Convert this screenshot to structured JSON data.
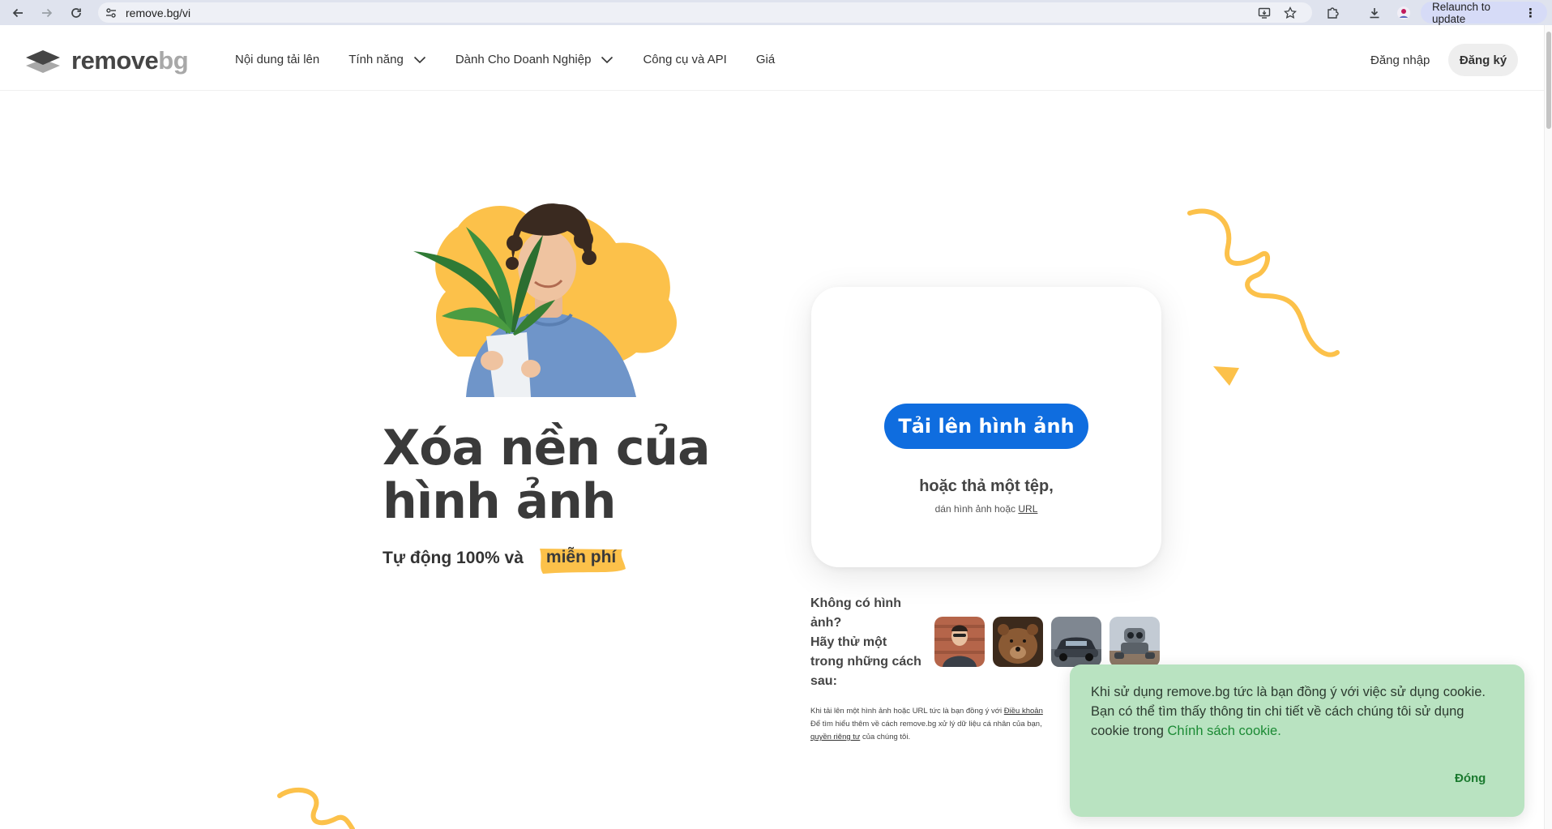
{
  "browser": {
    "url": "remove.bg/vi",
    "relaunch_label": "Relaunch to update"
  },
  "header": {
    "logo_text_main": "remove",
    "logo_text_bg": "bg",
    "menu": [
      {
        "label": "Nội dung tải lên",
        "has_dropdown": false
      },
      {
        "label": "Tính năng",
        "has_dropdown": true
      },
      {
        "label": "Dành Cho Doanh Nghiệp",
        "has_dropdown": true
      },
      {
        "label": "Công cụ và API",
        "has_dropdown": false
      },
      {
        "label": "Giá",
        "has_dropdown": false
      }
    ],
    "login_label": "Đăng nhập",
    "signup_label": "Đăng ký"
  },
  "hero": {
    "title_line1": "Xóa nền của",
    "title_line2": "hình ảnh",
    "subtitle_prefix": "Tự động 100% và",
    "subtitle_highlight": "miễn phí"
  },
  "upload": {
    "button_label": "Tải lên hình ảnh",
    "drop_text": "hoặc thả một tệp,",
    "paste_text": "dán hình ảnh hoặc",
    "paste_link": "URL"
  },
  "samples": {
    "line1": "Không có hình",
    "line2": "ảnh?",
    "line3": "Hãy thử một",
    "line4": "trong những cách",
    "line5": "sau:",
    "thumbs": [
      "person",
      "bear",
      "car",
      "robot"
    ]
  },
  "legal": {
    "line1_prefix": "Khi tải lên một hình ảnh hoặc URL tức là bạn đồng ý với",
    "line1_link": "Điều khoản",
    "line2": "Để tìm hiểu thêm về cách remove.bg xử lý dữ liệu cá nhân của bạn,",
    "line3_link": "quyền riêng tư",
    "line3_suffix": "của chúng tôi."
  },
  "cookie": {
    "message": "Khi sử dụng remove.bg tức là bạn đồng ý với việc sử dụng cookie. Bạn có thể tìm thấy thông tin chi tiết về cách chúng tôi sử dụng cookie trong",
    "policy_link": "Chính sách cookie.",
    "close_label": "Đóng"
  },
  "colors": {
    "primary": "#0f6ddf",
    "accent_yellow": "#fcc14a",
    "cookie_bg": "#b9e3c1",
    "cookie_link": "#1b8a34"
  }
}
